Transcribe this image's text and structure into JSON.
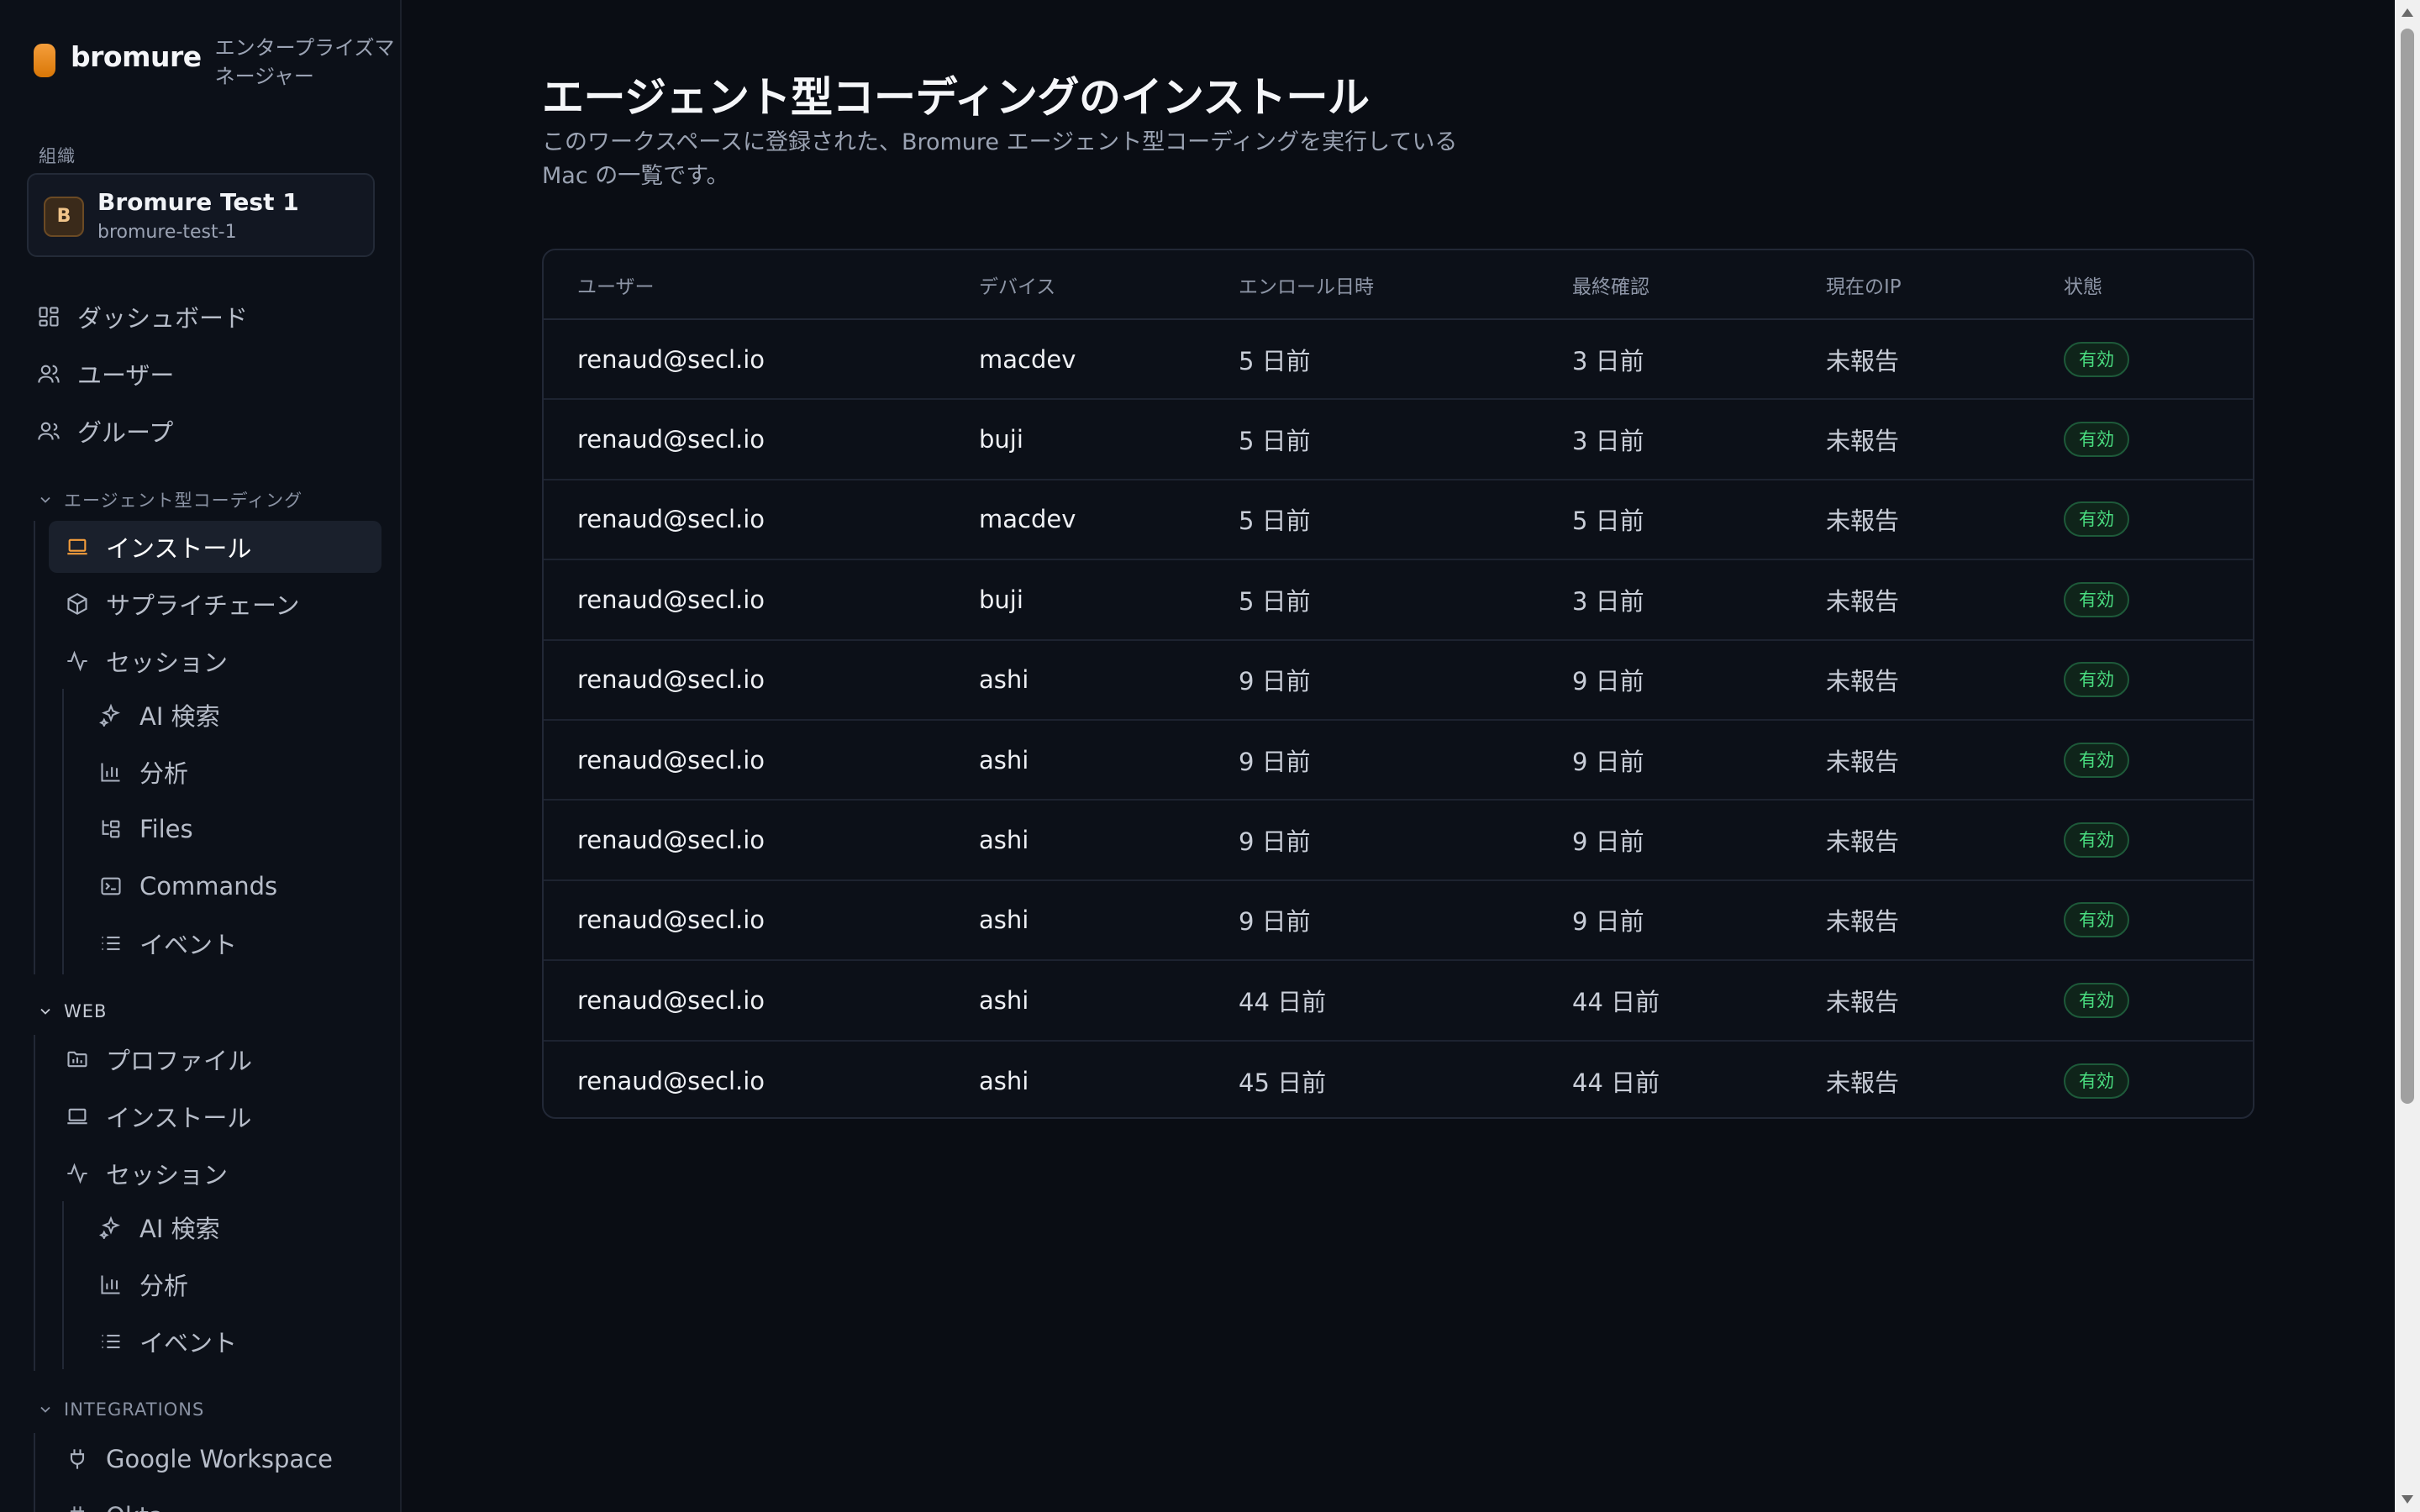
{
  "brand": {
    "name": "bromure",
    "subtitle": "エンタープライズマネージャー"
  },
  "org": {
    "section_label": "組織",
    "avatar": "B",
    "name": "Bromure Test 1",
    "slug": "bromure-test-1"
  },
  "nav": {
    "dashboard": "ダッシュボード",
    "users": "ユーザー",
    "groups": "グループ"
  },
  "agentic": {
    "heading": "エージェント型コーディング",
    "install": "インストール",
    "supply_chain": "サプライチェーン",
    "sessions": "セッション",
    "ai_search": "AI 検索",
    "analytics": "分析",
    "files": "Files",
    "commands": "Commands",
    "events": "イベント"
  },
  "web": {
    "heading": "WEB",
    "profiles": "プロファイル",
    "install": "インストール",
    "sessions": "セッション",
    "ai_search": "AI 検索",
    "analytics": "分析",
    "events": "イベント"
  },
  "integrations": {
    "heading": "INTEGRATIONS",
    "google": "Google Workspace",
    "next": "Okta"
  },
  "page": {
    "title": "エージェント型コーディングのインストール",
    "description": "このワークスペースに登録された、Bromure エージェント型コーディングを実行している Mac の一覧です。"
  },
  "table": {
    "headers": {
      "user": "ユーザー",
      "device": "デバイス",
      "enrolled": "エンロール日時",
      "last_seen": "最終確認",
      "ip": "現在のIP",
      "status": "状態"
    },
    "rows": [
      {
        "user": "renaud@secl.io",
        "device": "macdev",
        "enrolled": "5 日前",
        "last_seen": "3 日前",
        "ip": "未報告",
        "status": "有効"
      },
      {
        "user": "renaud@secl.io",
        "device": "buji",
        "enrolled": "5 日前",
        "last_seen": "3 日前",
        "ip": "未報告",
        "status": "有効"
      },
      {
        "user": "renaud@secl.io",
        "device": "macdev",
        "enrolled": "5 日前",
        "last_seen": "5 日前",
        "ip": "未報告",
        "status": "有効"
      },
      {
        "user": "renaud@secl.io",
        "device": "buji",
        "enrolled": "5 日前",
        "last_seen": "3 日前",
        "ip": "未報告",
        "status": "有効"
      },
      {
        "user": "renaud@secl.io",
        "device": "ashi",
        "enrolled": "9 日前",
        "last_seen": "9 日前",
        "ip": "未報告",
        "status": "有効"
      },
      {
        "user": "renaud@secl.io",
        "device": "ashi",
        "enrolled": "9 日前",
        "last_seen": "9 日前",
        "ip": "未報告",
        "status": "有効"
      },
      {
        "user": "renaud@secl.io",
        "device": "ashi",
        "enrolled": "9 日前",
        "last_seen": "9 日前",
        "ip": "未報告",
        "status": "有効"
      },
      {
        "user": "renaud@secl.io",
        "device": "ashi",
        "enrolled": "9 日前",
        "last_seen": "9 日前",
        "ip": "未報告",
        "status": "有効"
      },
      {
        "user": "renaud@secl.io",
        "device": "ashi",
        "enrolled": "44 日前",
        "last_seen": "44 日前",
        "ip": "未報告",
        "status": "有効"
      },
      {
        "user": "renaud@secl.io",
        "device": "ashi",
        "enrolled": "45 日前",
        "last_seen": "44 日前",
        "ip": "未報告",
        "status": "有効"
      }
    ]
  },
  "colors": {
    "accent": "#f59e3c",
    "status_green": "#4ade80",
    "background": "#0a0d14"
  }
}
